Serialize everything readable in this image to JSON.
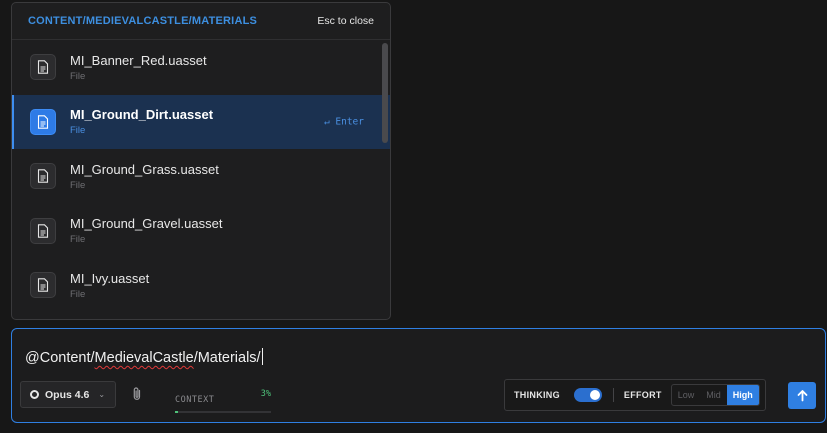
{
  "popup": {
    "path": "CONTENT/MEDIEVALCASTLE/MATERIALS",
    "close_hint": "Esc to close",
    "items": [
      {
        "name": "MI_Banner_Red.uasset",
        "type": "File",
        "icon": "file-icon"
      },
      {
        "name": "MI_Ground_Dirt.uasset",
        "type": "File",
        "icon": "file-icon",
        "selected": true,
        "hint": "↵ Enter"
      },
      {
        "name": "MI_Ground_Grass.uasset",
        "type": "File",
        "icon": "file-icon"
      },
      {
        "name": "MI_Ground_Gravel.uasset",
        "type": "File",
        "icon": "file-icon"
      },
      {
        "name": "MI_Ivy.uasset",
        "type": "File",
        "icon": "file-icon"
      }
    ]
  },
  "composer": {
    "input": {
      "prefix": "@Content/",
      "misspelled": "MedievalCastle",
      "suffix": "/Materials/"
    },
    "model": {
      "label": "Opus 4.6",
      "icon": "model-circle-icon"
    },
    "attach_icon": "paperclip-icon",
    "context": {
      "label": "CONTEXT",
      "percent_text": "3%",
      "percent": 3
    },
    "thinking": {
      "label": "THINKING",
      "enabled": true
    },
    "effort": {
      "label": "EFFORT",
      "options": [
        "Low",
        "Mid",
        "High"
      ],
      "selected": "High"
    },
    "send_icon": "arrow-up-icon"
  },
  "colors": {
    "accent": "#2f7fe2",
    "path_text": "#3d8fe0",
    "context_green": "#4fc27a",
    "selected_row_bg": "#1b3150"
  }
}
